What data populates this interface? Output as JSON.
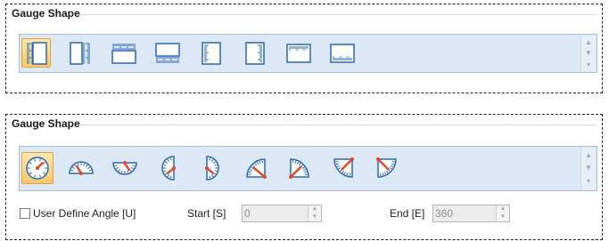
{
  "panel1": {
    "title": "Gauge Shape",
    "icons": [
      "linear-vertical-left-scale-icon",
      "linear-vertical-right-scale-icon",
      "linear-horizontal-top-scale-icon",
      "linear-horizontal-bottom-scale-icon",
      "thermometer-left-icon",
      "thermometer-right-icon",
      "ruler-top-icon",
      "ruler-bottom-icon"
    ],
    "selected_index": 0
  },
  "panel2": {
    "title": "Gauge Shape",
    "icons": [
      "circular-full-gauge-icon",
      "semicircle-top-gauge-icon",
      "semicircle-bottom-gauge-icon",
      "semicircle-left-gauge-icon",
      "semicircle-right-gauge-icon",
      "quarter-top-left-gauge-icon",
      "quarter-top-right-gauge-icon",
      "quarter-bottom-left-gauge-icon",
      "quarter-bottom-right-gauge-icon"
    ],
    "selected_index": 0,
    "user_define_angle_label": "User Define Angle [U]",
    "user_define_angle_checked": false,
    "start_label": "Start [S]",
    "start_value": "0",
    "end_label": "End [E]",
    "end_value": "360"
  },
  "colors": {
    "accent_blue": "#2a67b1",
    "needle": "#e0482a",
    "gallery_bg": "#dde8f6",
    "selected_bg": "#f8c86a"
  }
}
